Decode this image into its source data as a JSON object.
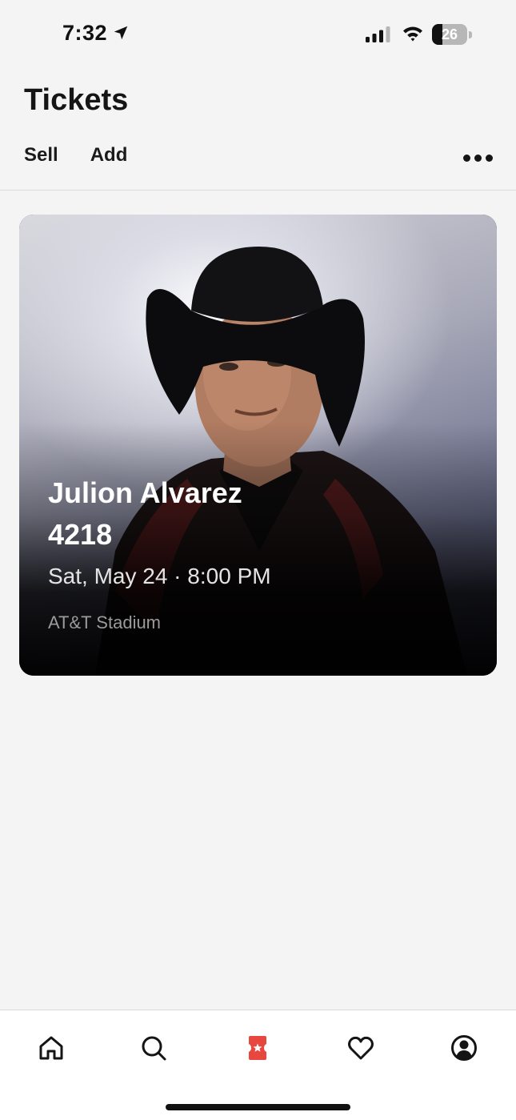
{
  "status_bar": {
    "time": "7:32",
    "battery_level": "26",
    "icons": [
      "location-arrow-icon",
      "cellular-signal-icon",
      "wifi-icon",
      "battery-icon"
    ]
  },
  "header": {
    "title": "Tickets",
    "actions": [
      "Sell",
      "Add"
    ],
    "more_icon": "more-dots-icon"
  },
  "ticket": {
    "artist": "Julion Alvarez",
    "code": "4218",
    "datetime": "Sat, May 24 · 8:00 PM",
    "venue": "AT&T Stadium"
  },
  "tab_bar": {
    "items": [
      {
        "icon": "home-icon",
        "active": false
      },
      {
        "icon": "search-icon",
        "active": false
      },
      {
        "icon": "ticket-icon",
        "active": true
      },
      {
        "icon": "heart-icon",
        "active": false
      },
      {
        "icon": "profile-icon",
        "active": false
      }
    ],
    "active_color": "#e8473f",
    "inactive_color": "#151515"
  }
}
